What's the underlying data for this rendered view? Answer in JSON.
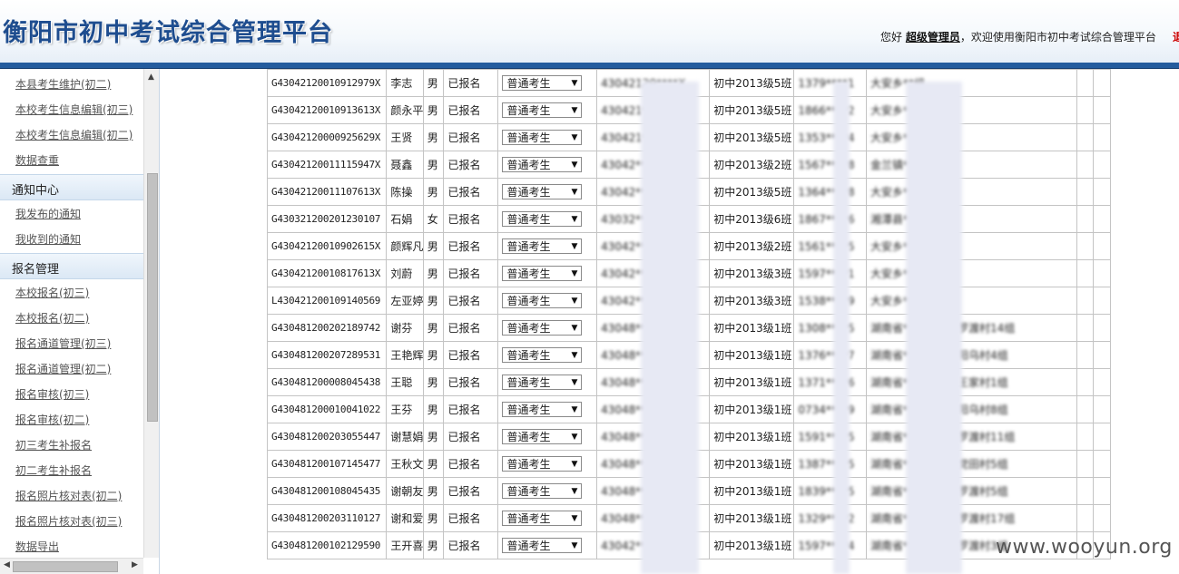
{
  "header": {
    "title": "衡阳市初中考试综合管理平台",
    "greeting": "您好",
    "user": "超级管理员",
    "welcome": "，欢迎使用衡阳市初中考试综合管理平台",
    "logout": "退"
  },
  "sidebar": {
    "items_top": [
      "本县考生维护(初二)",
      "本校考生信息编辑(初三)",
      "本校考生信息编辑(初二)",
      "数据查重"
    ],
    "notice_header": "通知中心",
    "notice_items": [
      "我发布的通知",
      "我收到的通知"
    ],
    "signup_header": "报名管理",
    "signup_items": [
      "本校报名(初三)",
      "本校报名(初二)",
      "报名通道管理(初三)",
      "报名通道管理(初二)",
      "报名审核(初三)",
      "报名审核(初二)",
      "初三考生补报名",
      "初二考生补报名",
      "报名照片核对表(初二)",
      "报名照片核对表(初三)",
      "数据导出"
    ]
  },
  "table": {
    "select_default": "普通考生",
    "rows": [
      {
        "kh": "G43042120010912979X",
        "name": "李志",
        "sex": "男",
        "status": "已报名",
        "id": "43042120****X",
        "cls": "初中2013级5班",
        "phone": "1379****1",
        "addr": "大安乡**组"
      },
      {
        "kh": "G43042120010913613X",
        "name": "颜永平",
        "sex": "男",
        "status": "已报名",
        "id": "430421****X",
        "cls": "初中2013级5班",
        "phone": "1866****2",
        "addr": "大安乡**组"
      },
      {
        "kh": "G43042120000925629X",
        "name": "王贤",
        "sex": "男",
        "status": "已报名",
        "id": "430421****X",
        "cls": "初中2013级5班",
        "phone": "1353****4",
        "addr": "大安乡**组"
      },
      {
        "kh": "G43042120011115947X",
        "name": "聂鑫",
        "sex": "男",
        "status": "已报名",
        "id": "43042****7X",
        "cls": "初中2013级2班",
        "phone": "1567****8",
        "addr": "金兰镇**组"
      },
      {
        "kh": "G43042120011107613X",
        "name": "陈操",
        "sex": "男",
        "status": "已报名",
        "id": "43042****3X",
        "cls": "初中2013级5班",
        "phone": "1364****8",
        "addr": "大安乡**组"
      },
      {
        "kh": "G430321200201230107",
        "name": "石娟",
        "sex": "女",
        "status": "已报名",
        "id": "43032****07",
        "cls": "初中2013级6班",
        "phone": "1867****6",
        "addr": "湘潭县**村上游组"
      },
      {
        "kh": "G43042120010902615X",
        "name": "颜辉凡",
        "sex": "男",
        "status": "已报名",
        "id": "43042****5X",
        "cls": "初中2013级2班",
        "phone": "1561****5",
        "addr": "大安乡**组"
      },
      {
        "kh": "G43042120010817613X",
        "name": "刘蔚",
        "sex": "男",
        "status": "已报名",
        "id": "43042****3X",
        "cls": "初中2013级3班",
        "phone": "1597****1",
        "addr": "大安乡**组"
      },
      {
        "kh": "L430421200109140569",
        "name": "左亚婷",
        "sex": "男",
        "status": "已报名",
        "id": "43042****5X",
        "cls": "初中2013级3班",
        "phone": "1538****9",
        "addr": "大安乡**组"
      },
      {
        "kh": "G430481200202189742",
        "name": "谢芬",
        "sex": "男",
        "status": "已报名",
        "id": "43048****42",
        "cls": "初中2013级1班",
        "phone": "1308****5",
        "addr": "湖南省**市仁义乡罗渡村14组"
      },
      {
        "kh": "G430481200207289531",
        "name": "王艳辉",
        "sex": "男",
        "status": "已报名",
        "id": "43048****31",
        "cls": "初中2013级1班",
        "phone": "1376****7",
        "addr": "湖南省**市仁义乡阳乌村4组"
      },
      {
        "kh": "G430481200008045438",
        "name": "王聪",
        "sex": "男",
        "status": "已报名",
        "id": "43048****38",
        "cls": "初中2013级1班",
        "phone": "1371****6",
        "addr": "湖南省**市仁义乡王家村1组"
      },
      {
        "kh": "G430481200010041022",
        "name": "王芬",
        "sex": "男",
        "status": "已报名",
        "id": "43048****22",
        "cls": "初中2013级1班",
        "phone": "0734****9",
        "addr": "湖南省**市仁义乡阳乌村8组"
      },
      {
        "kh": "G430481200203055447",
        "name": "谢慧娟",
        "sex": "男",
        "status": "已报名",
        "id": "43048****47",
        "cls": "初中2013级1班",
        "phone": "1591****5",
        "addr": "湖南省**市仁义乡罗渡村11组"
      },
      {
        "kh": "G430481200107145477",
        "name": "王秋文",
        "sex": "男",
        "status": "已报名",
        "id": "43048****77",
        "cls": "初中2013级1班",
        "phone": "1387****5",
        "addr": "湖南省**市仁义乡党田村5组"
      },
      {
        "kh": "G430481200108045435",
        "name": "谢朝友",
        "sex": "男",
        "status": "已报名",
        "id": "43048****35",
        "cls": "初中2013级1班",
        "phone": "1839****5",
        "addr": "湖南省**市仁义乡罗渡村5组"
      },
      {
        "kh": "G430481200203110127",
        "name": "谢和爱",
        "sex": "男",
        "status": "已报名",
        "id": "43048****27",
        "cls": "初中2013级1班",
        "phone": "1329****2",
        "addr": "湖南省**市仁义乡罗渡村17组"
      },
      {
        "kh": "G430481200102129590",
        "name": "王开喜",
        "sex": "男",
        "status": "已报名",
        "id": "43042****90",
        "cls": "初中2013级1班",
        "phone": "1597****4",
        "addr": "湖南省**市耒**乡罗渡村3组"
      }
    ]
  },
  "watermark": "www.wooyun.org",
  "colors": {
    "header_bar": "#245c9e",
    "title": "#1e4d8f",
    "logout": "#cc0000"
  }
}
